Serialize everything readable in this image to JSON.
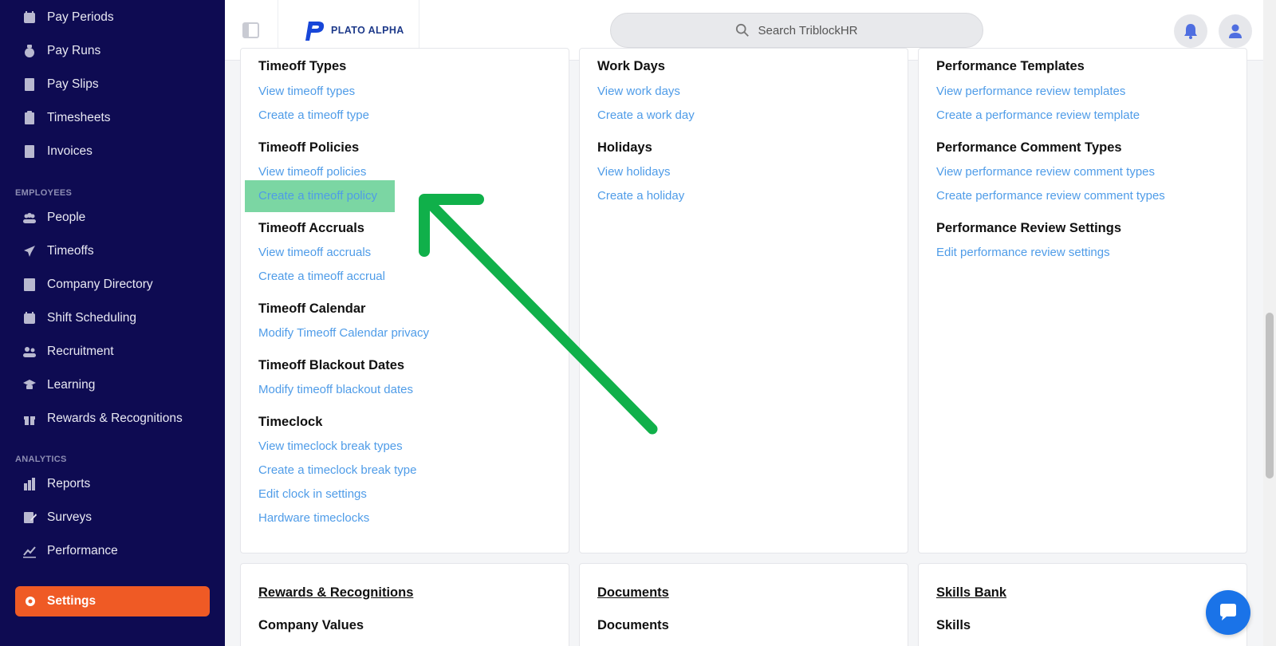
{
  "sidebar": {
    "top_items": [
      {
        "label": "Pay Periods",
        "icon": "calendar-icon"
      },
      {
        "label": "Pay Runs",
        "icon": "money-bag-icon"
      },
      {
        "label": "Pay Slips",
        "icon": "receipt-icon"
      },
      {
        "label": "Timesheets",
        "icon": "clipboard-icon"
      },
      {
        "label": "Invoices",
        "icon": "invoice-icon"
      }
    ],
    "employees_label": "EMPLOYEES",
    "employee_items": [
      {
        "label": "People",
        "icon": "people-icon"
      },
      {
        "label": "Timeoffs",
        "icon": "plane-icon"
      },
      {
        "label": "Company Directory",
        "icon": "address-book-icon"
      },
      {
        "label": "Shift Scheduling",
        "icon": "calendar-icon"
      },
      {
        "label": "Recruitment",
        "icon": "users-icon"
      },
      {
        "label": "Learning",
        "icon": "graduation-cap-icon"
      },
      {
        "label": "Rewards & Recognitions",
        "icon": "gift-icon"
      }
    ],
    "analytics_label": "ANALYTICS",
    "analytics_items": [
      {
        "label": "Reports",
        "icon": "bar-chart-icon"
      },
      {
        "label": "Surveys",
        "icon": "edit-icon"
      },
      {
        "label": "Performance",
        "icon": "line-chart-icon"
      }
    ],
    "settings": {
      "label": "Settings",
      "icon": "gear-icon"
    }
  },
  "topbar": {
    "logo_text": "PLATO ALPHA",
    "search_placeholder": "Search TriblockHR"
  },
  "columns": {
    "col1": {
      "sections": [
        {
          "title": "Timeoff Types",
          "links": [
            "View timeoff types",
            "Create a timeoff type"
          ]
        },
        {
          "title": "Timeoff Policies",
          "links": [
            "View timeoff policies",
            "Create a timeoff policy"
          ]
        },
        {
          "title": "Timeoff Accruals",
          "links": [
            "View timeoff accruals",
            "Create a timeoff accrual"
          ]
        },
        {
          "title": "Timeoff Calendar",
          "links": [
            "Modify Timeoff Calendar privacy"
          ]
        },
        {
          "title": "Timeoff Blackout Dates",
          "links": [
            "Modify timeoff blackout dates"
          ]
        },
        {
          "title": "Timeclock",
          "links": [
            "View timeclock break types",
            "Create a timeclock break type",
            "Edit clock in settings",
            "Hardware timeclocks"
          ]
        }
      ]
    },
    "col2": {
      "sections": [
        {
          "title": "Work Days",
          "links": [
            "View work days",
            "Create a work day"
          ]
        },
        {
          "title": "Holidays",
          "links": [
            "View holidays",
            "Create a holiday"
          ]
        }
      ]
    },
    "col3": {
      "sections": [
        {
          "title": "Performance Templates",
          "links": [
            "View performance review templates",
            "Create a performance review template"
          ]
        },
        {
          "title": "Performance Comment Types",
          "links": [
            "View performance review comment types",
            "Create performance review comment types"
          ]
        },
        {
          "title": "Performance Review Settings",
          "links": [
            "Edit performance review settings"
          ]
        }
      ]
    }
  },
  "bottom_cards": [
    {
      "title": "Rewards & Recognitions",
      "subtitle": "Company Values"
    },
    {
      "title": "Documents",
      "subtitle": "Documents"
    },
    {
      "title": "Skills Bank",
      "subtitle": "Skills"
    }
  ],
  "colors": {
    "sidebar_bg": "#0e0b52",
    "settings_accent": "#ef5a25",
    "link": "#4f9ce8",
    "highlight": "#7bd6a3",
    "arrow": "#10b04a"
  }
}
